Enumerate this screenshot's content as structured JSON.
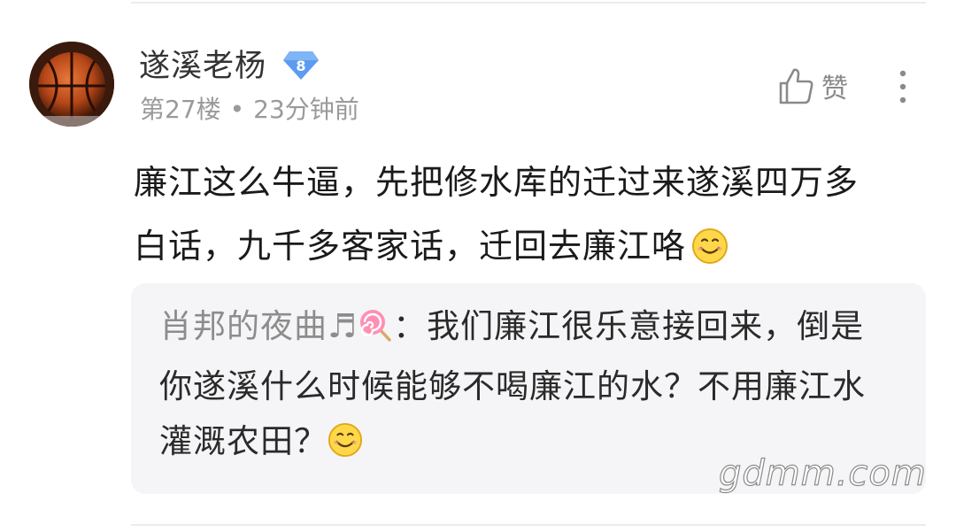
{
  "comment": {
    "username": "遂溪老杨",
    "level": "8",
    "floor": "第27楼",
    "separator": "•",
    "time": "23分钟前",
    "like_label": "赞",
    "content_line1": "廉江这么牛逼，先把修水库的迁过来遂溪四万多",
    "content_line2": "白话，九千多客家话，迁回去廉江咯",
    "quote": {
      "author": "肖邦的夜曲♬",
      "separator": "：",
      "line1_after_author": "我们廉江很乐意接回来，倒是",
      "line2": "你遂溪什么时候能够不喝廉江的水？不用廉江水",
      "line3": "灌溉农田？"
    }
  },
  "watermark": "gdmm.com",
  "icons": {
    "avatar": "basketball-avatar",
    "badge": "diamond-level-badge-icon",
    "like": "thumbs-up-icon",
    "more": "more-vertical-icon",
    "smiley": "smiley-emoji-icon",
    "lollipop": "lollipop-emoji-icon"
  },
  "colors": {
    "badge": "#5b9cf2",
    "username": "#333333",
    "meta": "#9a9a9a",
    "quote_bg": "#f5f5f7"
  }
}
